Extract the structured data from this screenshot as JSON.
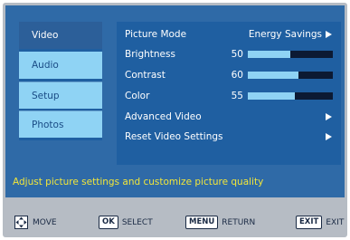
{
  "sidebar": {
    "items": [
      {
        "label": "Video"
      },
      {
        "label": "Audio"
      },
      {
        "label": "Setup"
      },
      {
        "label": "Photos"
      }
    ]
  },
  "content": {
    "rows": [
      {
        "label": "Picture Mode",
        "value": "Energy Savings"
      },
      {
        "label": "Brightness",
        "value": "50",
        "level": 50
      },
      {
        "label": "Contrast",
        "value": "60",
        "level": 60
      },
      {
        "label": "Color",
        "value": "55",
        "level": 55
      },
      {
        "label": "Advanced Video"
      },
      {
        "label": "Reset Video Settings"
      }
    ]
  },
  "description": "Adjust picture settings and customize picture quality",
  "footer": {
    "move": "MOVE",
    "ok_key": "OK",
    "select": "SELECT",
    "menu_key": "MENU",
    "return": "RETURN",
    "exit_key": "EXIT",
    "exit": "EXIT"
  },
  "colors": {
    "panel": "#1f5fa1",
    "frame": "#2f6aa7",
    "highlight": "#8fd3f4",
    "desc_text": "#f2e63a"
  },
  "icons": [
    "right-arrow-icon",
    "move-arrows-icon"
  ]
}
